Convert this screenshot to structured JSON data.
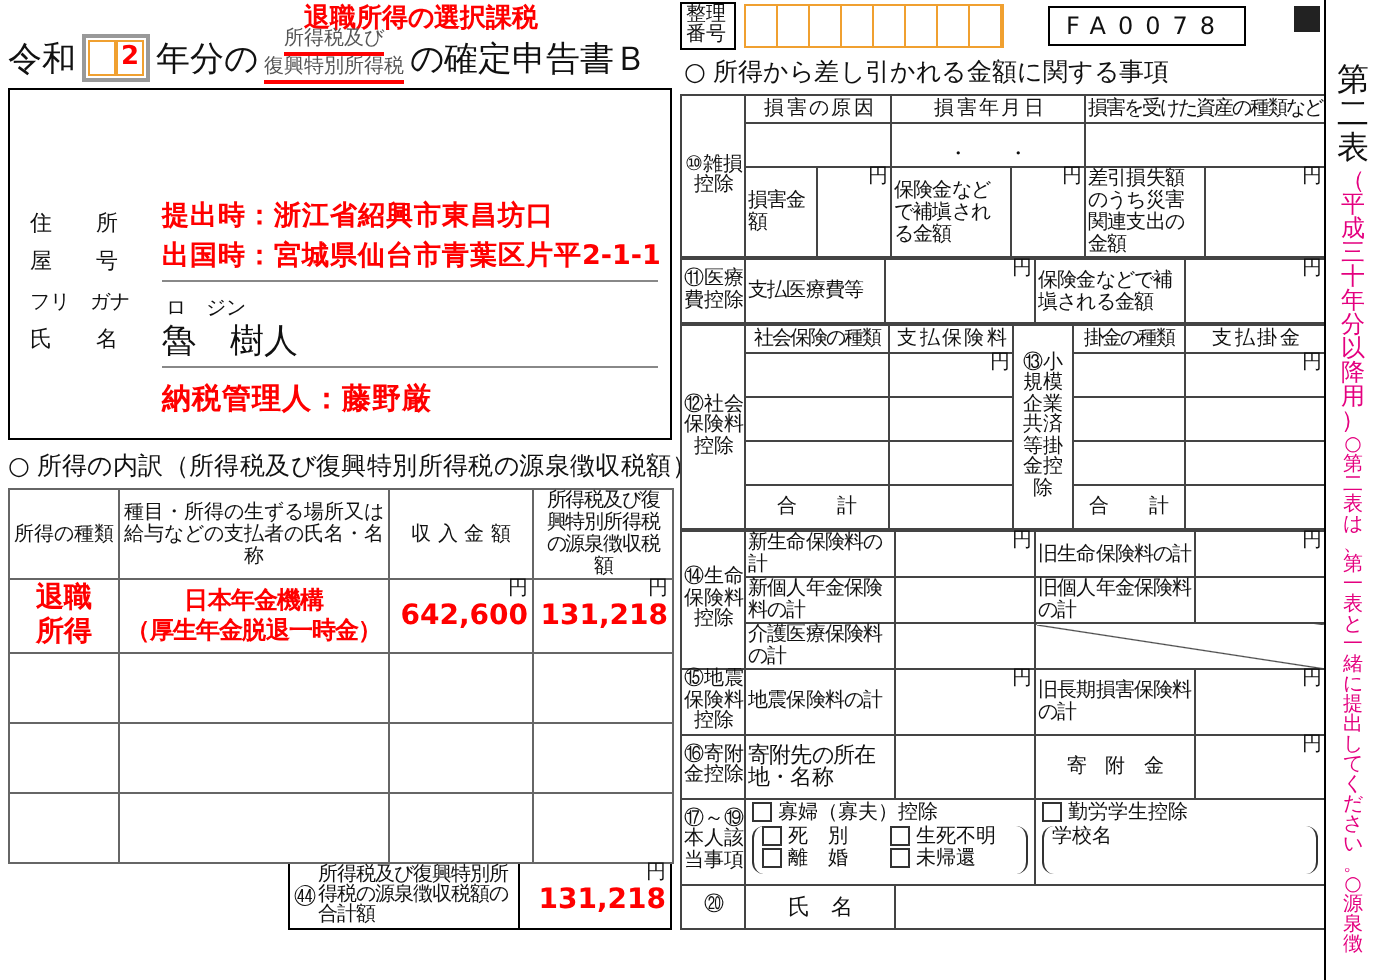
{
  "header": {
    "annotation": "退職所得の選択課税",
    "era": "令和",
    "year": "2",
    "title_prefix": "年分の",
    "struck_lines": [
      "所得税及び",
      "復興特別所得税"
    ],
    "title_suffix": "の確定申告書Ｂ"
  },
  "address_box": {
    "address_label": "住　　所",
    "trade_name_label": "屋　　号",
    "furigana_label": "フリ　ガナ",
    "name_label": "氏　　名",
    "address_lines": [
      "提出時：浙江省紹興市東昌坊口",
      "出国時：宮城県仙台市青葉区片平2-1-1"
    ],
    "name_reading": "ロ　ジン",
    "name": "魯　樹人",
    "tax_agent": "納税管理人：藤野厳"
  },
  "income_breakdown": {
    "title": "○ 所得の内訳（所得税及び復興特別所得税の源泉徴収税額）",
    "columns": [
      "所得の種類",
      "種目・所得の生ずる場所又は給与などの支払者の氏名・名称",
      "収 入 金 額",
      "所得税及び復興特別所得税の源泉徴収税額"
    ],
    "rows": [
      {
        "type": "退職所得",
        "payer_lines": [
          "日本年金機構",
          "（厚生年金脱退一時金）"
        ],
        "income": "642,600",
        "income_unit": "円",
        "tax": "131,218",
        "tax_unit": "円"
      }
    ],
    "total": {
      "number": "㊹",
      "label": "所得税及び復興特別所得税の源泉徴収税額の合計額",
      "value": "131,218",
      "unit": "円"
    }
  },
  "reference": {
    "label": "整理番号",
    "form_code": "FA0078"
  },
  "deductions": {
    "title": "○ 所得から差し引かれる金額に関する事項",
    "casualty": {
      "number": "⑩",
      "label": "雑損控除",
      "columns": [
        "損 害 の 原 因",
        "損 害 年 月 日",
        "損害を受けた資産の種類など"
      ],
      "date_separators": [
        "・",
        "・"
      ],
      "fields": [
        {
          "label": "損害金額",
          "unit": "円"
        },
        {
          "label": "保険金などで補塡される金額",
          "unit": "円"
        },
        {
          "label": "差引損失額のうち災害関連支出の金額",
          "unit": "円"
        }
      ]
    },
    "medical": {
      "number": "⑪",
      "label": "医療費控除",
      "fields": [
        {
          "label": "支払医療費等",
          "unit": "円"
        },
        {
          "label": "保険金などで補塡される金額",
          "unit": "円"
        }
      ]
    },
    "social_insurance": {
      "number": "⑫",
      "label": "社会保険料控除",
      "columns": [
        "社会保険の種類",
        "支 払 保 険 料"
      ],
      "unit": "円",
      "total_label": "合　　計"
    },
    "small_business": {
      "number": "⑬",
      "label": "小規模企業共済等掛金控除",
      "columns": [
        "掛金の種類",
        "支 払 掛 金"
      ],
      "unit": "円",
      "total_label": "合　　計"
    },
    "life_insurance": {
      "number": "⑭",
      "label": "生命保険料控除",
      "fields": [
        {
          "label": "新生命保険料の計",
          "unit": "円"
        },
        {
          "label": "旧生命保険料の計",
          "unit": "円"
        },
        {
          "label": "新個人年金保険料の計"
        },
        {
          "label": "旧個人年金保険料の計"
        },
        {
          "label": "介護医療保険料の計"
        }
      ]
    },
    "earthquake": {
      "number": "⑮",
      "label": "地震保険料控除",
      "fields": [
        {
          "label": "地震保険料の計",
          "unit": "円"
        },
        {
          "label": "旧長期損害保険料の計",
          "unit": "円"
        }
      ]
    },
    "donation": {
      "number": "⑯",
      "label": "寄附金控除",
      "fields": [
        {
          "label": "寄附先の所在地・名称"
        },
        {
          "label": "寄　附　金",
          "unit": "円"
        }
      ]
    },
    "personal": {
      "number": "⑰～⑲",
      "label": "本人該当事項",
      "options": [
        {
          "label": "寡婦（寡夫）控除",
          "checked": false,
          "suboptions": [
            {
              "label": "死　別",
              "checked": false
            },
            {
              "label": "生死不明",
              "checked": false
            },
            {
              "label": "離　婚",
              "checked": false
            },
            {
              "label": "未帰還",
              "checked": false
            }
          ]
        },
        {
          "label": "勤労学生控除",
          "checked": false,
          "school_label": "学校名"
        }
      ]
    },
    "dependents": {
      "number": "⑳",
      "name_label": "氏　名"
    }
  },
  "side_note": {
    "form_name": "第二表",
    "edition": "（平成三十年分以降用）",
    "instruction": "○第二表は、第一表と一緒に提出してください。○源泉徴"
  }
}
